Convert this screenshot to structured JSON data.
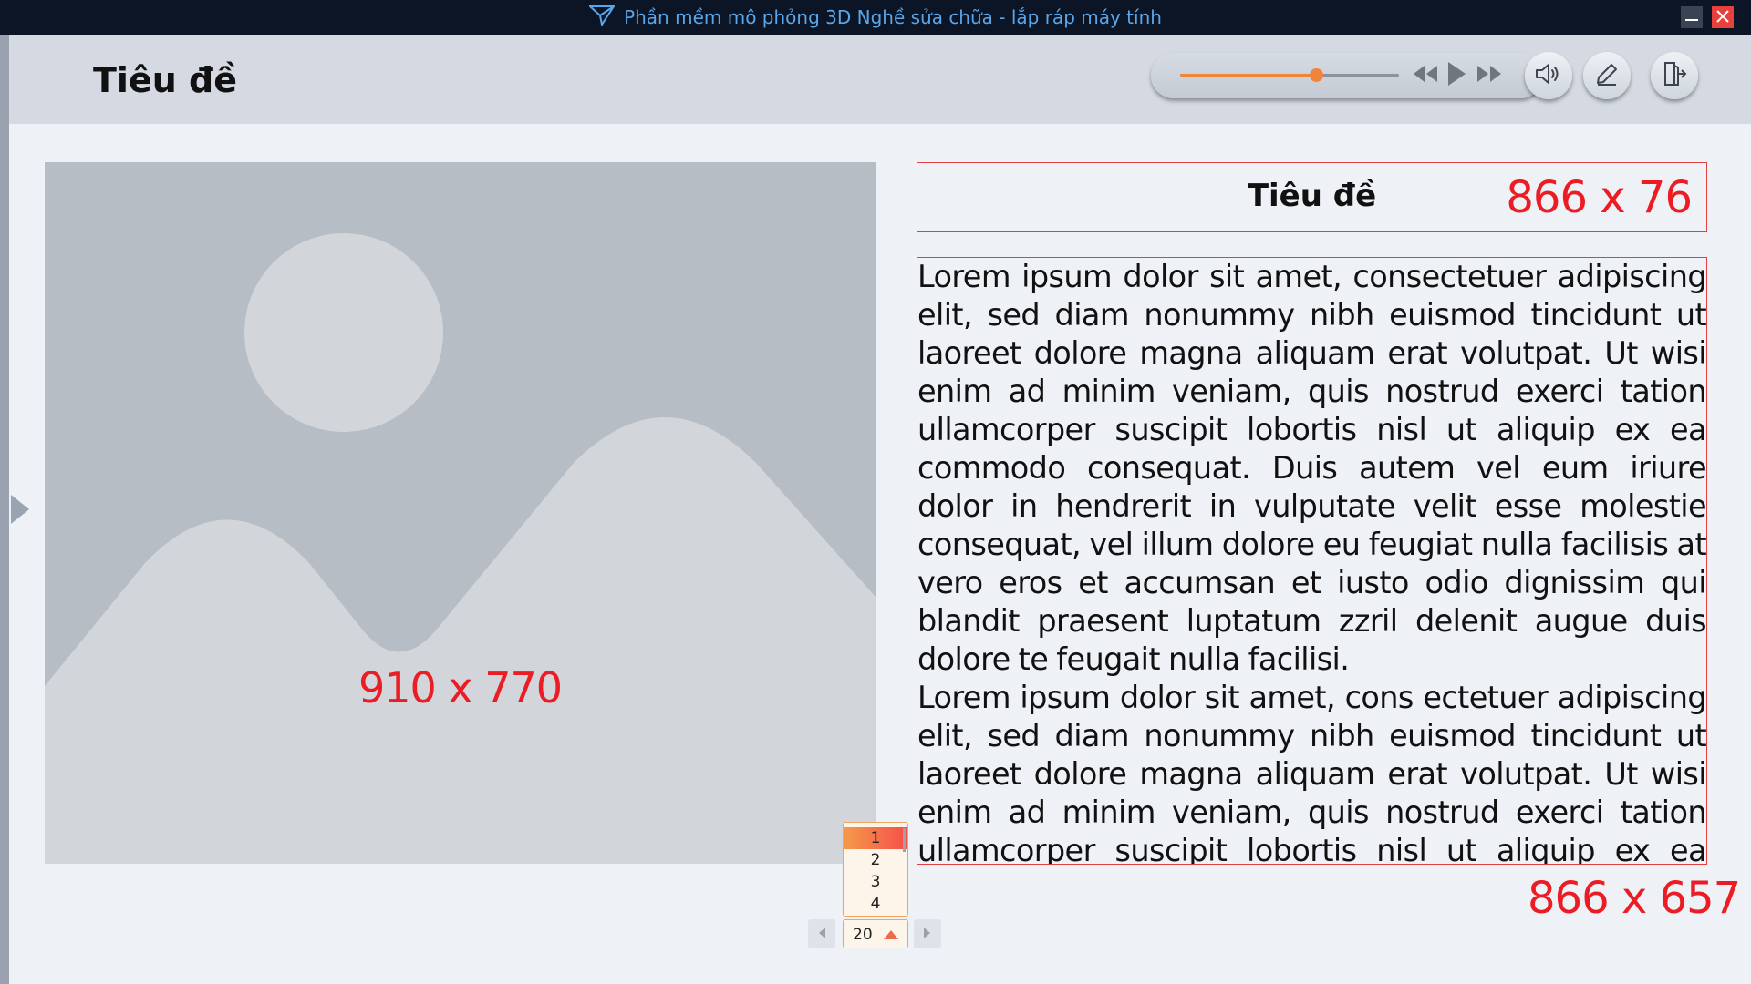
{
  "window": {
    "title": "Phần mềm mô phỏng 3D Nghề sửa chữa - lắp ráp máy tính",
    "logo_icon": "paper-plane-logo-icon",
    "minimize_icon": "minimize-icon",
    "close_icon": "close-icon"
  },
  "header": {
    "title": "Tiêu đề",
    "volume_level_percent": 62,
    "icons": [
      "rewind-icon",
      "play-icon",
      "fast-forward-icon",
      "speaker-icon",
      "edit-icon",
      "exit-icon"
    ],
    "accent_color": "#f0843a"
  },
  "image_placeholder": {
    "label": "910 x 770"
  },
  "content": {
    "title": "Tiêu đề",
    "title_dim_label": "866 x 76",
    "paragraphs": [
      "Lorem ipsum dolor sit amet, consectetuer adipiscing elit, sed diam nonummy nibh euismod tincidunt ut laoreet dolore magna aliquam erat volutpat. Ut wisi enim ad minim veniam, quis nostrud exerci tation ullamcorper suscipit lobortis nisl ut aliquip ex ea commodo consequat. Duis autem vel eum iriure dolor in hendrerit in vulputate velit esse molestie consequat, vel illum dolore eu feugiat nulla facilisis at vero eros et accumsan et iusto odio dignissim qui blandit praesent luptatum zzril delenit augue duis dolore te feugait nulla facilisi.",
      "Lorem ipsum dolor sit amet, cons ectetuer adipiscing elit, sed diam nonummy nibh euismod tincidunt ut laoreet dolore magna aliquam erat volutpat. Ut wisi enim ad minim veniam, quis nostrud exerci tation ullamcorper suscipit lobortis nisl ut aliquip ex ea commodo consequat."
    ],
    "text_dim_label": "866 x 657",
    "dim_color": "#ec1c24"
  },
  "pager": {
    "options": [
      "1",
      "2",
      "3",
      "4"
    ],
    "selected": "1",
    "current_value": "20",
    "prev_icon": "caret-left-icon",
    "next_icon": "caret-right-icon"
  }
}
